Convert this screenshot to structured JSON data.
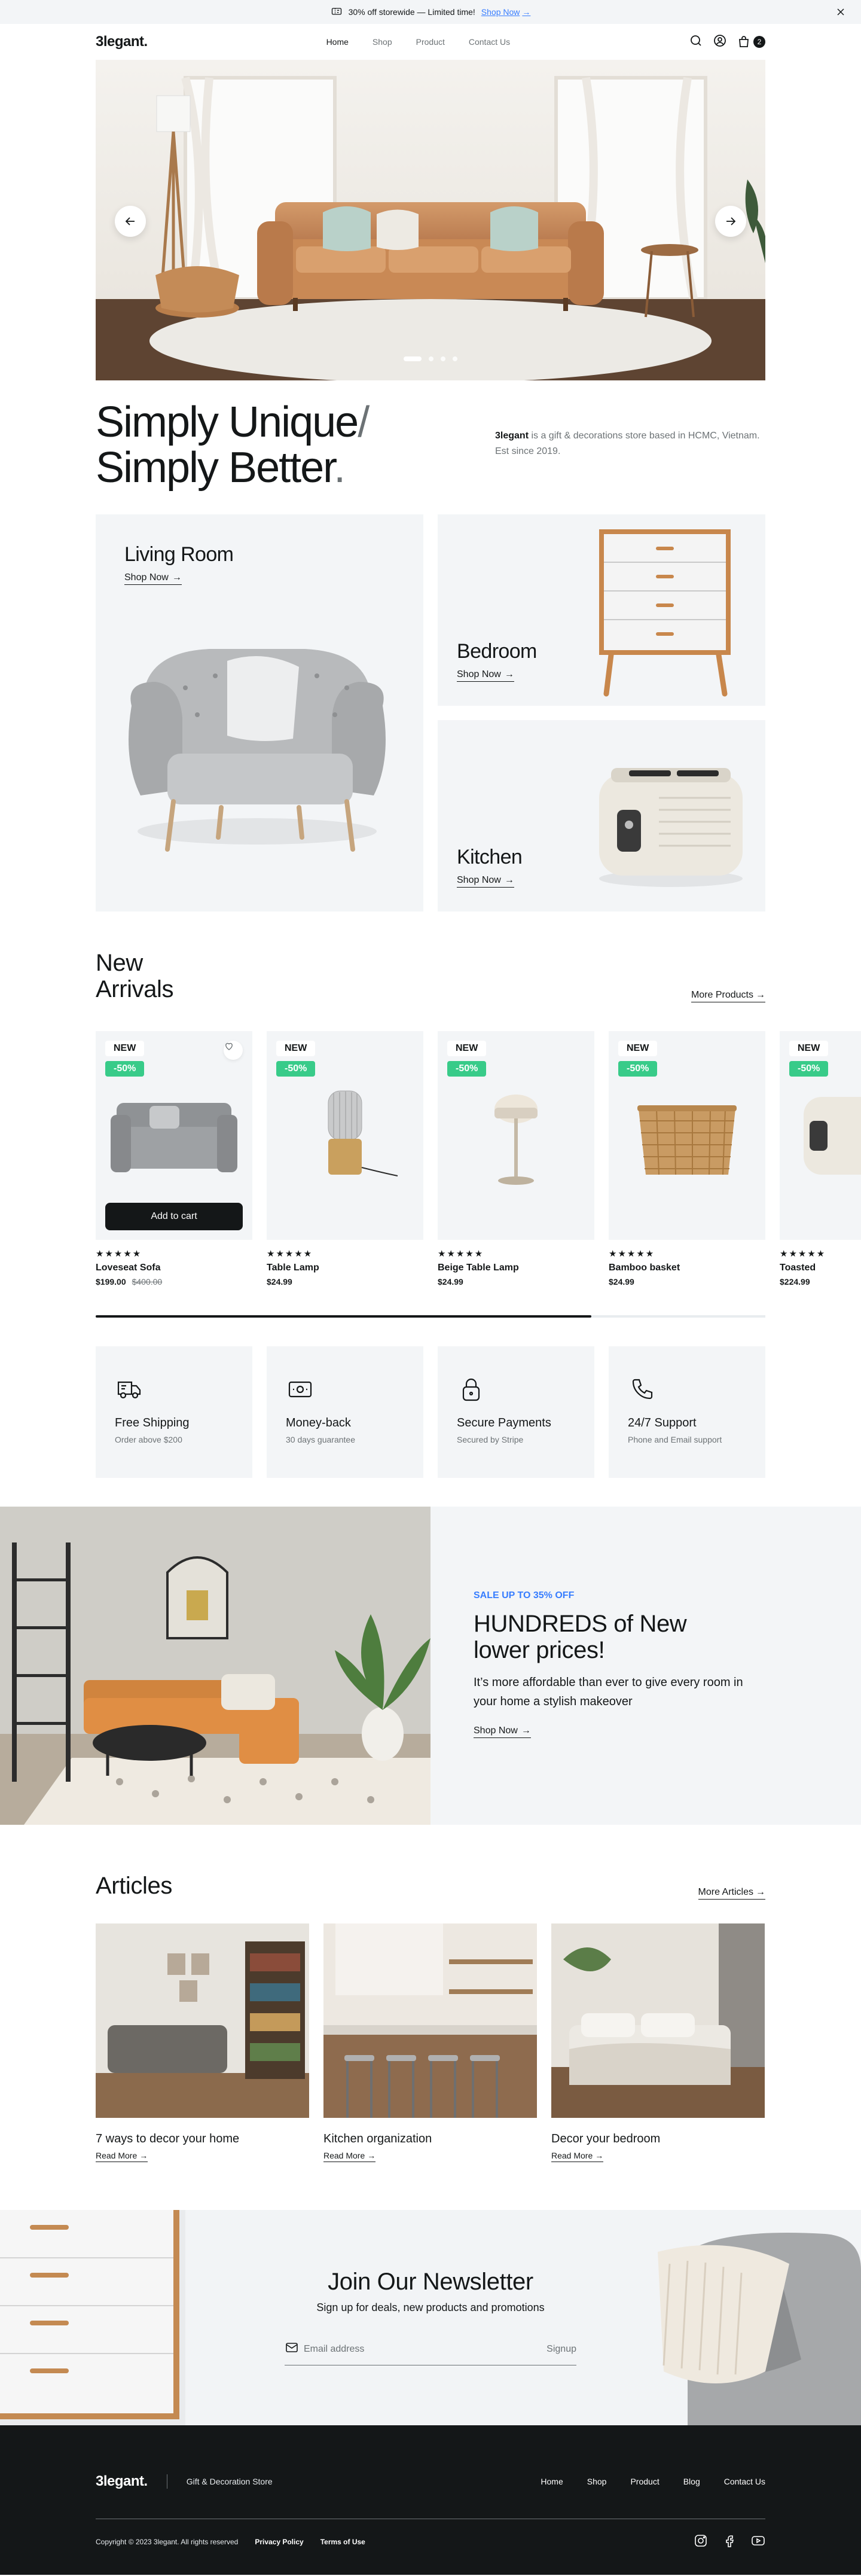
{
  "topbar": {
    "message": "30% off storewide — Limited time!",
    "link": "Shop Now"
  },
  "nav": {
    "logo": "3legant.",
    "links": [
      "Home",
      "Shop",
      "Product",
      "Contact Us"
    ],
    "cart_count": "2"
  },
  "hero": {
    "slides": 4,
    "active_slide": 1
  },
  "intro": {
    "title_line1": "Simply Unique",
    "title_slash": "/",
    "title_line2": "Simply Better",
    "title_dot": ".",
    "desc_brand": "3legant",
    "desc_rest": " is a gift & decorations store based in HCMC, Vietnam. Est since 2019."
  },
  "categories": [
    {
      "title": "Living Room",
      "link": "Shop Now"
    },
    {
      "title": "Bedroom",
      "link": "Shop Now"
    },
    {
      "title": "Kitchen",
      "link": "Shop Now"
    }
  ],
  "arrivals": {
    "title": "New Arrivals",
    "more": "More Products",
    "products": [
      {
        "badge": "NEW",
        "discount": "-50%",
        "name": "Loveseat Sofa",
        "price": "$199.00",
        "old_price": "$400.00",
        "stars": "★★★★★",
        "cta": "Add to cart"
      },
      {
        "badge": "NEW",
        "discount": "-50%",
        "name": "Table Lamp",
        "price": "$24.99",
        "stars": "★★★★★"
      },
      {
        "badge": "NEW",
        "discount": "-50%",
        "name": "Beige Table Lamp",
        "price": "$24.99",
        "stars": "★★★★★"
      },
      {
        "badge": "NEW",
        "discount": "-50%",
        "name": "Bamboo basket",
        "price": "$24.99",
        "stars": "★★★★★"
      },
      {
        "badge": "NEW",
        "discount": "-50%",
        "name": "Toasted",
        "price": "$224.99",
        "stars": "★★★★★"
      }
    ],
    "scroll_progress": 0.74
  },
  "services": [
    {
      "title": "Free Shipping",
      "sub": "Order above $200",
      "icon": "truck-icon"
    },
    {
      "title": "Money-back",
      "sub": "30 days guarantee",
      "icon": "money-icon"
    },
    {
      "title": "Secure Payments",
      "sub": "Secured by Stripe",
      "icon": "lock-icon"
    },
    {
      "title": "24/7 Support",
      "sub": "Phone and Email support",
      "icon": "phone-icon"
    }
  ],
  "banner": {
    "kicker": "SALE UP TO 35% OFF",
    "title": "HUNDREDS of New lower prices!",
    "text": "It’s more affordable than ever to give every room in your home a stylish makeover",
    "link": "Shop Now"
  },
  "articles": {
    "title": "Articles",
    "more": "More Articles",
    "items": [
      {
        "title": "7 ways to decor your home",
        "link": "Read More"
      },
      {
        "title": "Kitchen organization",
        "link": "Read More"
      },
      {
        "title": "Decor your bedroom",
        "link": "Read More"
      }
    ]
  },
  "newsletter": {
    "title": "Join Our Newsletter",
    "sub": "Sign up for deals, new products and promotions",
    "placeholder": "Email address",
    "button": "Signup"
  },
  "footer": {
    "logo": "3legant.",
    "tagline": "Gift & Decoration Store",
    "links": [
      "Home",
      "Shop",
      "Product",
      "Blog",
      "Contact Us"
    ],
    "copyright": "Copyright © 2023 3legant. All rights reserved",
    "privacy": "Privacy Policy",
    "terms": "Terms of Use"
  },
  "colors": {
    "accent": "#377DFF",
    "dark": "#141718",
    "green": "#38CB89",
    "muted": "#6C7275",
    "light_bg": "#F3F5F7"
  }
}
